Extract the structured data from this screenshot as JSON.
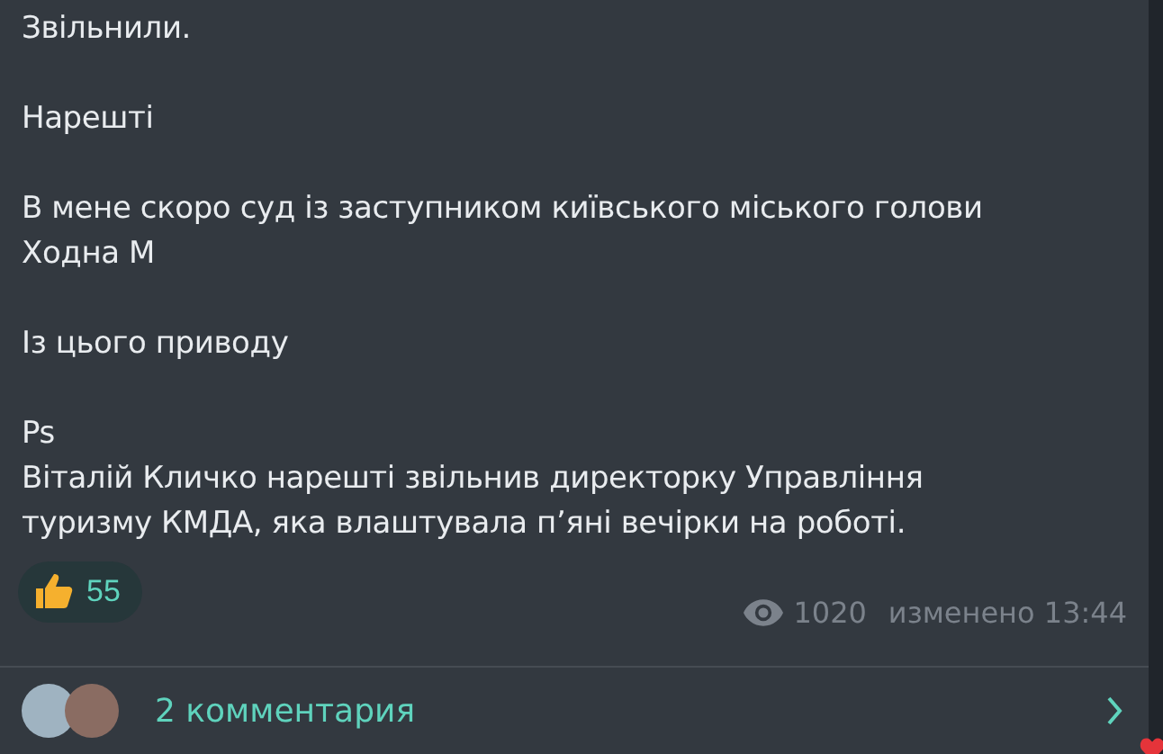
{
  "message": {
    "paragraphs": [
      [
        "Звільнили."
      ],
      [
        "Нарешті"
      ],
      [
        "В мене скоро суд із заступником київського міського голови",
        "Ходна М"
      ],
      [
        "Із цього приводу"
      ],
      [
        "Ps",
        "Віталій Кличко нарешті звільнив директорку Управління",
        "туризму КМДА, яка влаштувала п’яні вечірки на роботі."
      ]
    ],
    "reactions": [
      {
        "count": "55",
        "selected": false
      }
    ],
    "views": "1020",
    "edited": "изменено 13:44"
  },
  "comments": {
    "label": "2 комментария"
  }
}
